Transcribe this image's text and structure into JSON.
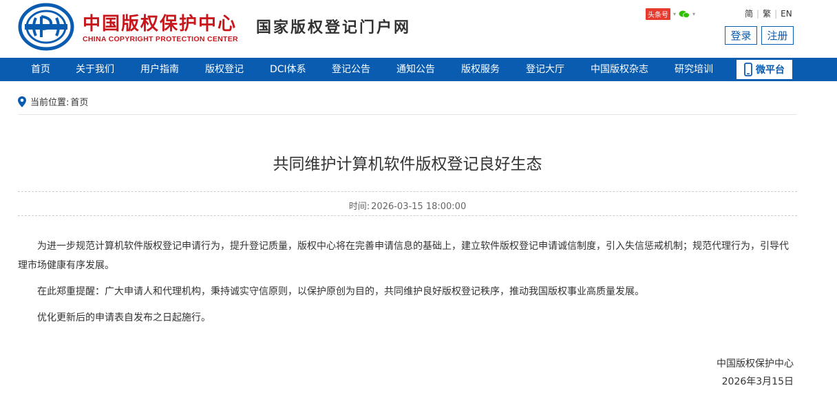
{
  "header": {
    "logo_cn": "中国版权保护中心",
    "logo_en": "CHINA COPYRIGHT PROTECTION CENTER",
    "portal_title": "国家版权登记门户网",
    "toutiao_label": "头条号",
    "lang": {
      "simplified": "简",
      "traditional": "繁",
      "english": "EN"
    },
    "login": "登录",
    "register": "注册"
  },
  "nav": {
    "items": [
      "首页",
      "关于我们",
      "用户指南",
      "版权登记",
      "DCI体系",
      "登记公告",
      "通知公告",
      "版权服务",
      "登记大厅",
      "中国版权杂志",
      "研究培训"
    ],
    "wpt_label": "微平台"
  },
  "breadcrumb": {
    "label": "当前位置:",
    "home": "首页"
  },
  "article": {
    "title": "共同维护计算机软件版权登记良好生态",
    "time_label": "时间:",
    "time_value": "2026-03-15 18:00:00",
    "paragraphs": [
      "为进一步规范计算机软件版权登记申请行为，提升登记质量，版权中心将在完善申请信息的基础上，建立软件版权登记申请诚信制度，引入失信惩戒机制；规范代理行为，引导代理市场健康有序发展。",
      "在此郑重提醒：广大申请人和代理机构，秉持诚实守信原则，以保护原创为目的，共同维护良好版权登记秩序，推动我国版权事业高质量发展。",
      "优化更新后的申请表自发布之日起施行。"
    ],
    "signature_org": "中国版权保护中心",
    "signature_date": "2026年3月15日"
  },
  "colors": {
    "brand_blue": "#0a5cb0",
    "brand_red": "#c8161d"
  }
}
